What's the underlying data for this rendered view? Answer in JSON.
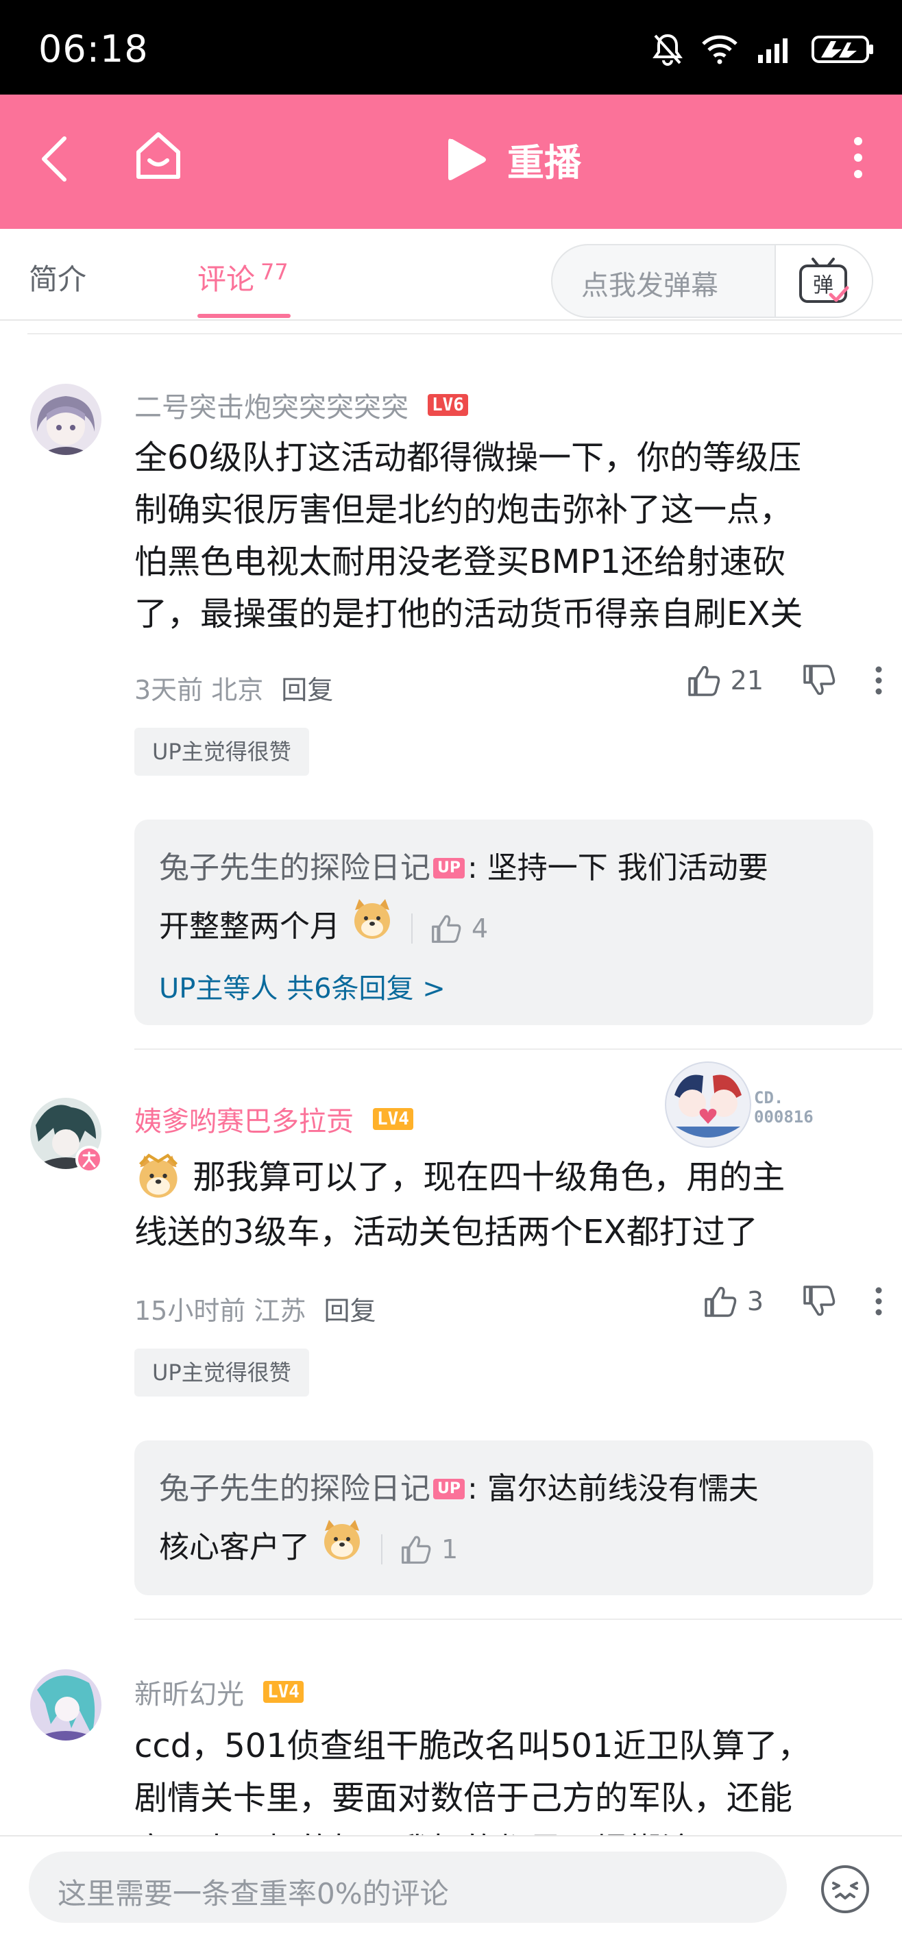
{
  "status_bar": {
    "time": "06:18"
  },
  "header": {
    "title": "重播"
  },
  "tabs": {
    "intro": "简介",
    "comments": "评论",
    "comment_count": "77"
  },
  "danmaku": {
    "placeholder": "点我发弹幕",
    "button": "弹"
  },
  "comments": [
    {
      "username": "二号突击炮突突突突突",
      "level": "LV6",
      "lines": [
        "全60级队打这活动都得微操一下，你的等级压",
        "制确实很厉害但是北约的炮击弥补了这一点，",
        "怕黑色电视太耐用没老登买BMP1还给射速砍",
        "了，最操蛋的是打他的活动货币得亲自刷EX关"
      ],
      "time_location": "3天前 北京",
      "reply_label": "回复",
      "likes": "21",
      "up_badge": "UP主觉得很赞",
      "sub_reply": {
        "author": "兔子先生的探险日记",
        "up_tag": "UP",
        "text_line1": ": 坚持一下 我们活动要",
        "text_line2": "开整整两个月",
        "likes": "4",
        "more": "UP主等人 共6条回复 >"
      }
    },
    {
      "username": "姨爹哟赛巴多拉贡",
      "level": "LV4",
      "fan_number": "CD.\n000816",
      "lines": [
        "那我算可以了，现在四十级角色，用的主",
        "线送的3级车，活动关包括两个EX都打过了"
      ],
      "time_location": "15小时前 江苏",
      "reply_label": "回复",
      "likes": "3",
      "up_badge": "UP主觉得很赞",
      "sub_reply": {
        "author": "兔子先生的探险日记",
        "up_tag": "UP",
        "text_line1": ": 富尔达前线没有懦夫",
        "text_line2": "核心客户了",
        "likes": "1"
      }
    },
    {
      "username": "新昕幻光",
      "level": "LV4",
      "lines": [
        "ccd，501侦查组干脆改名叫501近卫队算了，",
        "剧情关卡里，要面对数倍于己方的军队，还能",
        "赢下来，打的好，我打的都是一塌糊涂"
      ]
    }
  ],
  "bottom": {
    "placeholder": "这里需要一条查重率0%的评论"
  },
  "colors": {
    "accent": "#fb7299",
    "link": "#0a6a9c"
  }
}
